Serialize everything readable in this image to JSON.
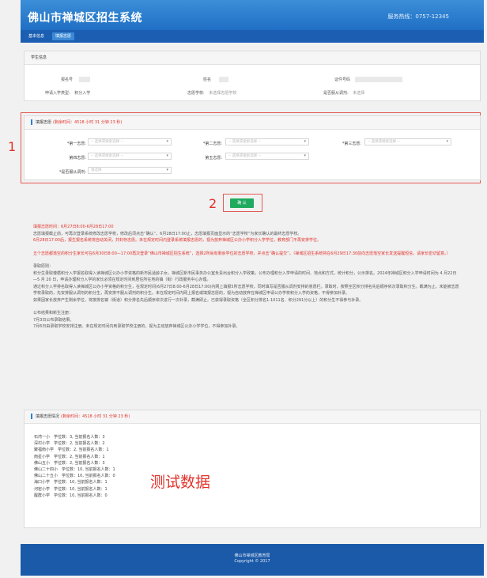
{
  "header": {
    "title": "佛山市禅城区招生系统",
    "hotline": "服务热线：0757-12345"
  },
  "nav": {
    "tabs": [
      "基本信息",
      "填报志愿"
    ]
  },
  "student": {
    "section_title": "学生信息",
    "reg_label": "报名号",
    "name_label": "姓名",
    "id_label": "证件号码",
    "type_label": "申请入学类型:",
    "type_value": "积分入学",
    "school_label": "志愿学校:",
    "school_value": "未选择志愿学校",
    "adjust_label": "是否服从调剂:",
    "adjust_value": "未选择"
  },
  "wish": {
    "section_title": "填报志愿",
    "remaining": "(剩余时间：4518 小时 31 分钟 23 秒)",
    "first_label": "*第一志愿:",
    "second_label": "*第二志愿:",
    "third_label": "*第三志愿:",
    "fourth_label": "第四志愿:",
    "fifth_label": "第五志愿:",
    "adjust_label": "*是否服从调剂:",
    "placeholder": "-- 选择或搜索选择 --",
    "adjust_placeholder": "请选择"
  },
  "annotations": {
    "one": "1",
    "two": "2"
  },
  "confirm_label": "确 认",
  "notice": {
    "time_title": "填报志愿时间：6月27日8:00-6月28日17:00",
    "p1": "志愿填报截止前，可再次登录系统修改志愿学校，修改后须点击“确认”。6月28日17:00止，志愿填报页面显示的“志愿学校”为家长确认的最终志愿学校。",
    "p2": "6月28日17:00后，报生报名系统将自动关闭，并封存志愿。未在规定时间内登录系统填报志愿的，视为放弃禅城区公办小学积分入学学位，教育部门不再安排学位。",
    "p3": "五个志愿都落空的积分生家长可在6月30日8:00—17:00再次登录“佛山市禅城区招生系统”，选择2所尚有剩余学位的志愿学校，并点击“确认提交”。（禅城区招生系统将在6月29日17:30前向志愿落空家长发送提醒短信，请家长密切留意。）",
    "rule_title": "录取原则：",
    "r1": "积分生录取遵循积分入学报名取得入读禅城区公办小学资格的新市民适龄子女。禅城区新市民事务办公室负责出台积分入学政策，公布办理积分入学申请的时间、地点和方式，统计积分，公示排名。2024年禅城区积分入学申请时间为 4 月22日—5 月 20 日，申请办理积分入学的家长必须在规定时间到居住所在地的镇（街）行政服务中心办理。",
    "r2": "通过积分入学排名取得入读禅城区公办小学资格的积分生，在规定时间(6月27日8:00-6月28日17:00)内网上填报5所志愿学校，同时填写是否服从调剂安排的意愿栏。录取时，按照全区积分排名先后顺序依次录取积分生。截满为止。未能被志愿学校录取的，先安排服从调剂的积分生，再安排不服从调剂的积分生。未在规定时间内网上报名或填报志愿的，视为自动放弃在禅城区申请公办学校积分入学的资格，不得参加补录。",
    "r3": "如果因家长放弃产生剩余学位，将按排名镇（街道）积分排名先后顺序依次进行一次补录，截满即止。已获得录取资格（全区积分排名1-1011名、积分291分以上）的积分生不得参与补录。",
    "result_title": "公布结果和新生注册：",
    "s1": "7月3日公布录取结果。",
    "s2": "7月6日由录取学校安排注册。未在规定时间内到录取学校注册的，视为主动放弃禅城区公办小学学位，不得参加补录。"
  },
  "status": {
    "section_title": "填报志愿情况",
    "remaining": "(剩余时间：4518 小时 31 分钟 23 秒)",
    "schools": [
      "石湾一小　学位数：3, 当前报名人数：3",
      "深村小学　学位数：2, 当前报名人数：2",
      "聚福南小学　学位数：2, 当前报名人数：1",
      "南星小学　学位数：2, 当前报名人数：1",
      "佛山五小　学位数：2, 当前报名人数：3",
      "佛山二十四小　学位数：10, 当前报名人数：1",
      "佛山二十五小　学位数：10, 当前报名人数：0",
      "海口小学　学位数：10, 当前报名人数：1",
      "河宕小学　学位数：10, 当前报名人数：1",
      "醒群小学　学位数：10, 当前报名人数：0"
    ],
    "test_label": "测试数据"
  },
  "footer": {
    "line1": "佛山市禅城区教育局",
    "line2": "Copyright © 2017"
  }
}
